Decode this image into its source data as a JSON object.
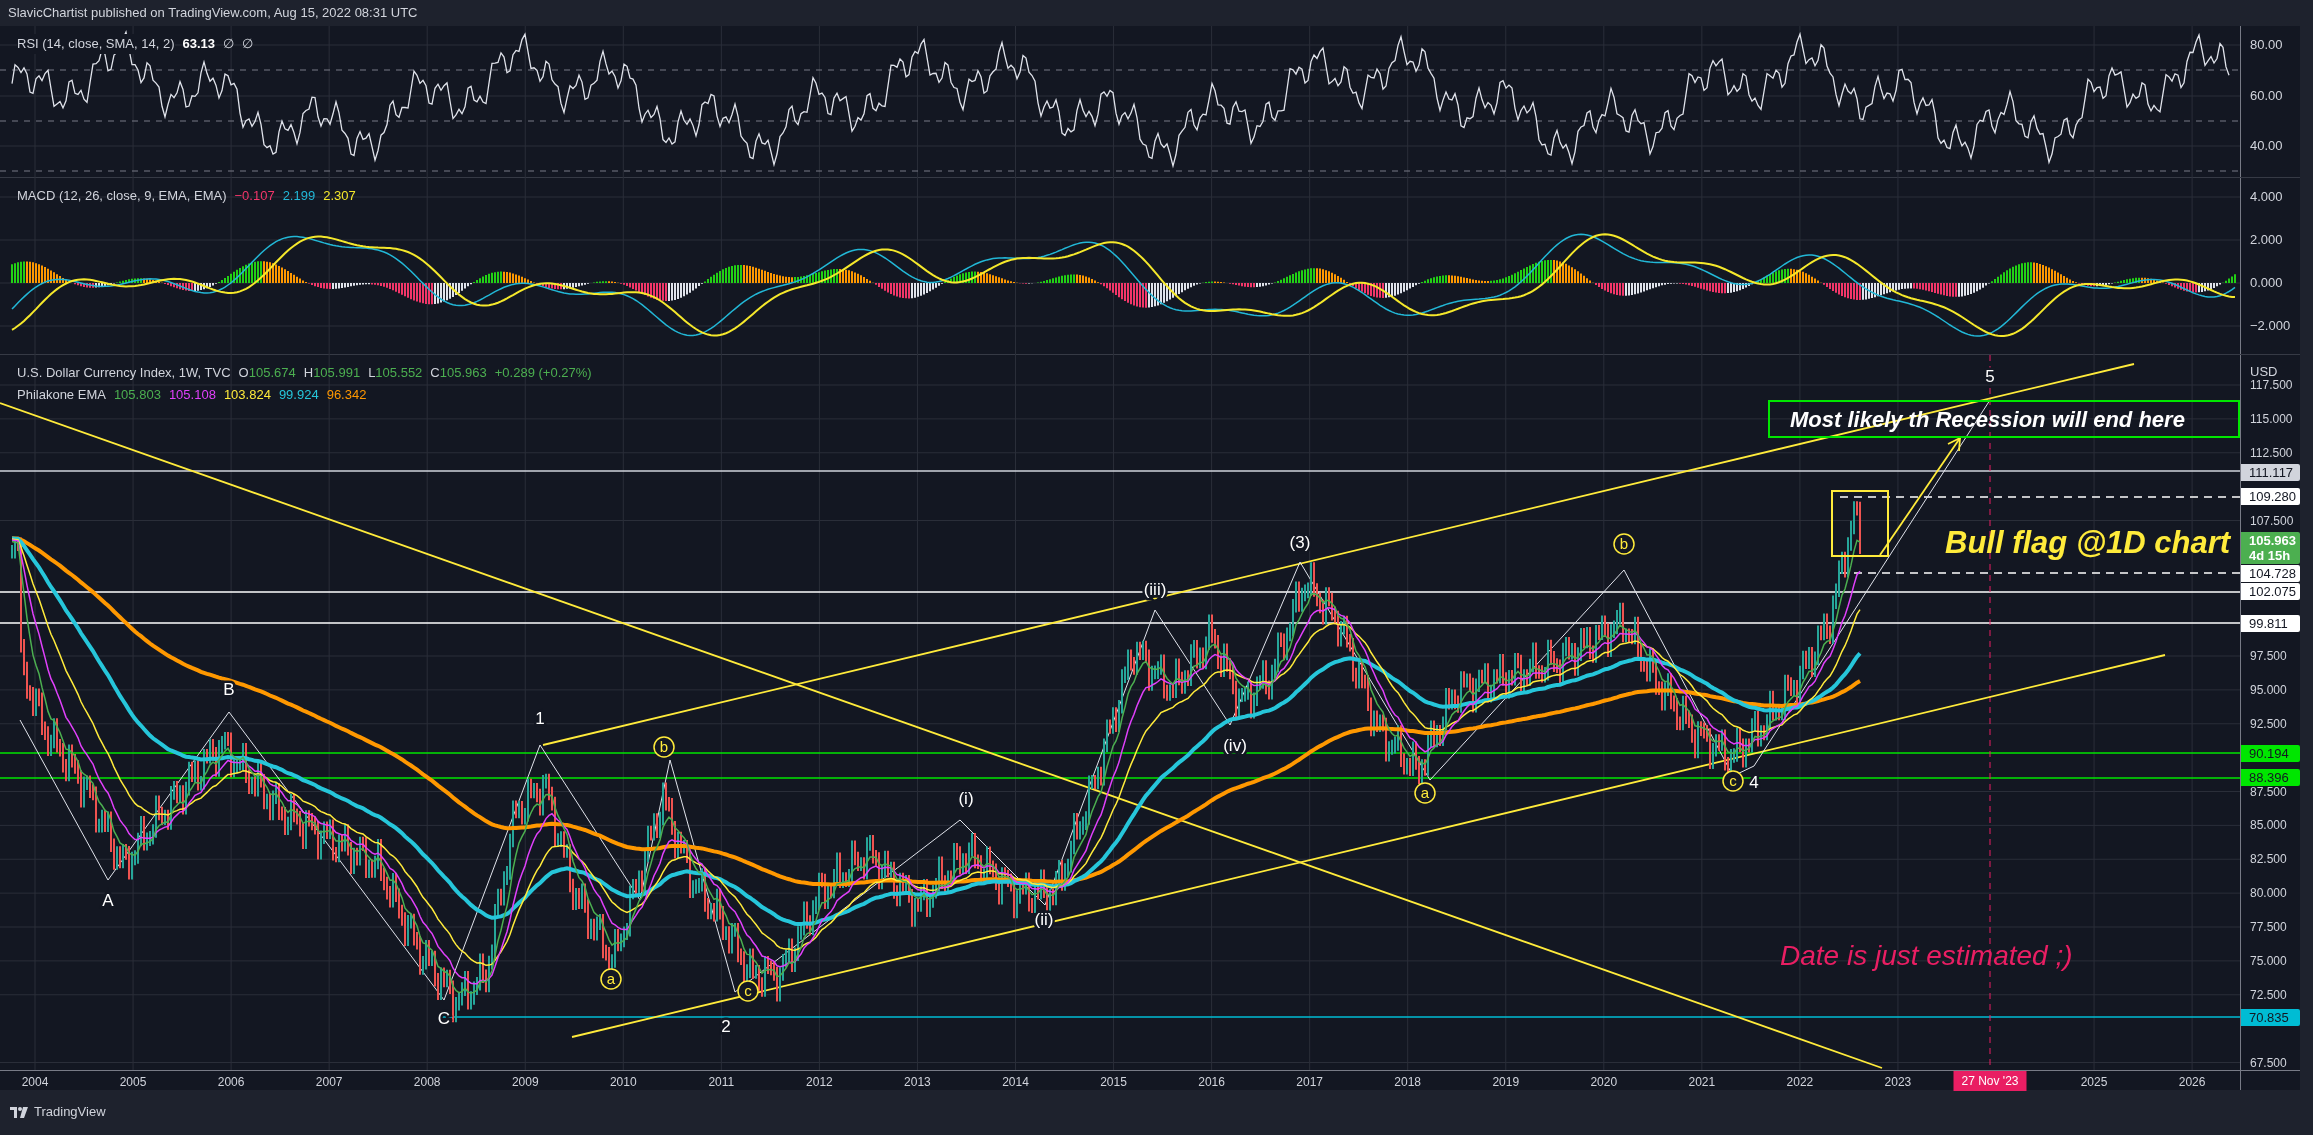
{
  "header": {
    "text": "SlavicChartist published on TradingView.com, Aug 15, 2022 08:31 UTC"
  },
  "rsi": {
    "legend": "RSI (14, close, SMA, 14, 2)",
    "value": "63.13",
    "extras": [
      "∅",
      "∅"
    ],
    "axis": [
      "80.00",
      "60.00",
      "40.00"
    ]
  },
  "macd": {
    "legend": "MACD (12, 26, close, 9, EMA, EMA)",
    "values": [
      {
        "text": "−0.107",
        "color": "#f23669"
      },
      {
        "text": "2.199",
        "color": "#22b7d6"
      },
      {
        "text": "2.307",
        "color": "#f5e82b"
      }
    ],
    "axis": [
      "4.000",
      "2.000",
      "0.000",
      "−2.000"
    ]
  },
  "main": {
    "symbol": "U.S. Dollar Currency Index, 1W, TVC",
    "ohlc": [
      {
        "label": "O",
        "value": "105.674"
      },
      {
        "label": "H",
        "value": "105.991"
      },
      {
        "label": "L",
        "value": "105.552"
      },
      {
        "label": "C",
        "value": "105.963"
      }
    ],
    "change": "+0.289 (+0.27%)",
    "ema_title": "Philakone EMA",
    "ema_values": [
      {
        "text": "105.803",
        "color": "#4caf50"
      },
      {
        "text": "105.108",
        "color": "#e040fb"
      },
      {
        "text": "103.824",
        "color": "#ffeb3b"
      },
      {
        "text": "99.924",
        "color": "#26c6da"
      },
      {
        "text": "96.342",
        "color": "#ff9800"
      }
    ],
    "currency": "USD",
    "axis": [
      "117.500",
      "115.000",
      "112.500",
      "107.500",
      "97.500",
      "95.000",
      "92.500",
      "87.500",
      "85.000",
      "82.500",
      "80.000",
      "77.500",
      "75.000",
      "72.500",
      "67.500"
    ],
    "price_tags": [
      {
        "text": "111.117",
        "color": "#d1d4dc"
      },
      {
        "text": "109.280",
        "color": "#ffffff"
      },
      {
        "text": "105.963",
        "sub": "4d 15h",
        "color": "#4caf50"
      },
      {
        "text": "104.728",
        "color": "#ffffff"
      },
      {
        "text": "102.075",
        "color": "#ffffff"
      },
      {
        "text": "99.811",
        "color": "#ffffff"
      },
      {
        "text": "90.194",
        "color": "#00e600"
      },
      {
        "text": "88.396",
        "color": "#00e600"
      },
      {
        "text": "70.835",
        "color": "#00bcd4"
      }
    ],
    "wave_labels": [
      {
        "text": "A",
        "kind": "plain"
      },
      {
        "text": "B",
        "kind": "plain"
      },
      {
        "text": "C",
        "kind": "plain"
      },
      {
        "text": "1",
        "kind": "plain"
      },
      {
        "text": "2",
        "kind": "plain"
      },
      {
        "text": "(3)",
        "kind": "plain"
      },
      {
        "text": "4",
        "kind": "plain"
      },
      {
        "text": "5",
        "kind": "plain"
      },
      {
        "text": "a",
        "kind": "circled"
      },
      {
        "text": "b",
        "kind": "circled"
      },
      {
        "text": "c",
        "kind": "circled"
      },
      {
        "text": "a",
        "kind": "circled"
      },
      {
        "text": "b",
        "kind": "circled"
      },
      {
        "text": "c",
        "kind": "circled"
      },
      {
        "text": "(i)",
        "kind": "plain"
      },
      {
        "text": "(ii)",
        "kind": "plain"
      },
      {
        "text": "(iii)",
        "kind": "plain"
      },
      {
        "text": "(iv)",
        "kind": "plain"
      }
    ],
    "annotations": [
      {
        "text": "Most likely th Recession will end here",
        "kind": "boxed"
      },
      {
        "text": "Bull flag @1D chart",
        "kind": "callout"
      },
      {
        "text": "Date is just estimated ;)",
        "kind": "note"
      }
    ]
  },
  "time_axis": {
    "years": [
      "2004",
      "2005",
      "2006",
      "2007",
      "2008",
      "2009",
      "2010",
      "2011",
      "2012",
      "2013",
      "2014",
      "2015",
      "2016",
      "2017",
      "2018",
      "2019",
      "2020",
      "2021",
      "2022",
      "2023",
      "2025",
      "2026"
    ],
    "marker": "27 Nov '23"
  },
  "footer": {
    "brand": "TradingView"
  }
}
